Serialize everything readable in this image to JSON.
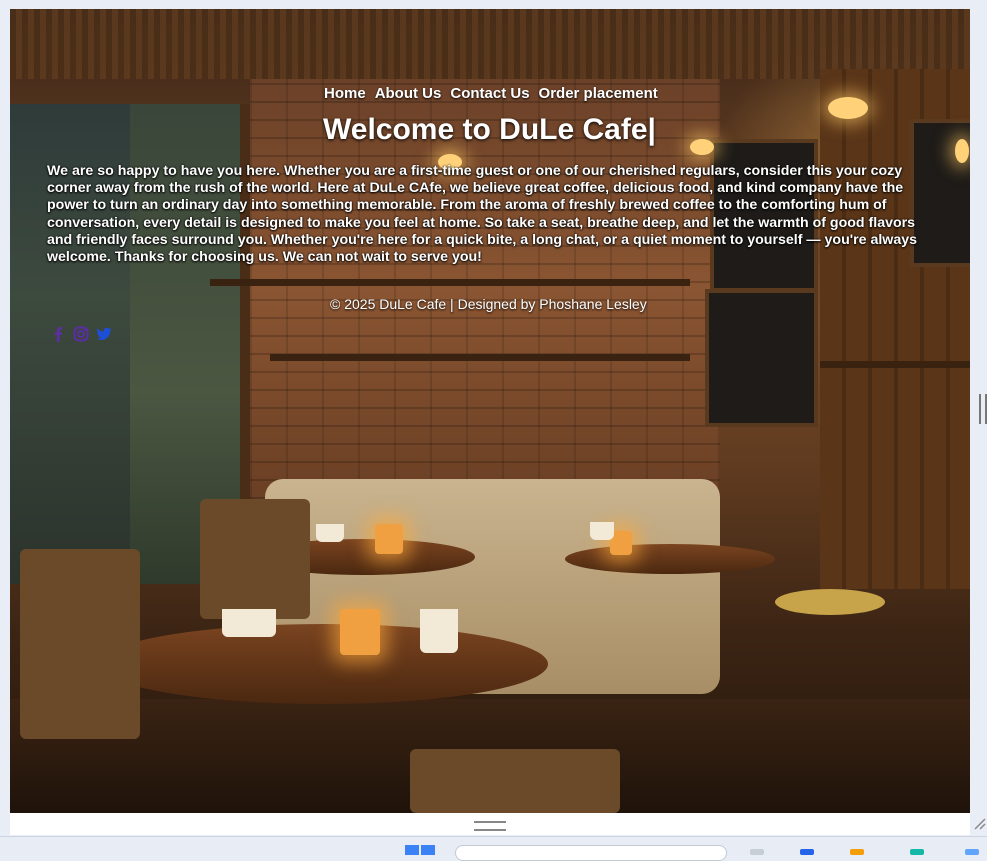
{
  "nav": {
    "items": [
      "Home",
      "About Us",
      "Contact Us",
      "Order placement"
    ]
  },
  "hero": {
    "title": "Welcome to DuLe Cafe|",
    "intro": "We are so happy to have you here. Whether you are a first-time guest or one of our cherished regulars, consider this your cozy corner away from the rush of the world. Here at DuLe CAfe, we believe great coffee, delicious food, and kind company have the power to turn an ordinary day into something memorable. From the aroma of freshly brewed coffee to the comforting hum of conversation, every detail is designed to make you feel at home. So take a seat, breathe deep, and let the warmth of good flavors and friendly faces surround you. Whether you're here for a quick bite, a long chat, or a quiet moment to yourself — you're always welcome. Thanks for choosing us. We can not wait to serve you!"
  },
  "footer": {
    "text": "© 2025 DuLe Cafe | Designed by Phoshane Lesley"
  },
  "social": {
    "icons": [
      "facebook-icon",
      "instagram-icon",
      "twitter-icon"
    ],
    "colors": {
      "facebook": "#5b2ea6",
      "instagram": "#5b2ea6",
      "twitter": "#1d4ed8"
    }
  },
  "colors": {
    "page_text": "#ffffff",
    "browser_chrome": "#e9eef6"
  }
}
